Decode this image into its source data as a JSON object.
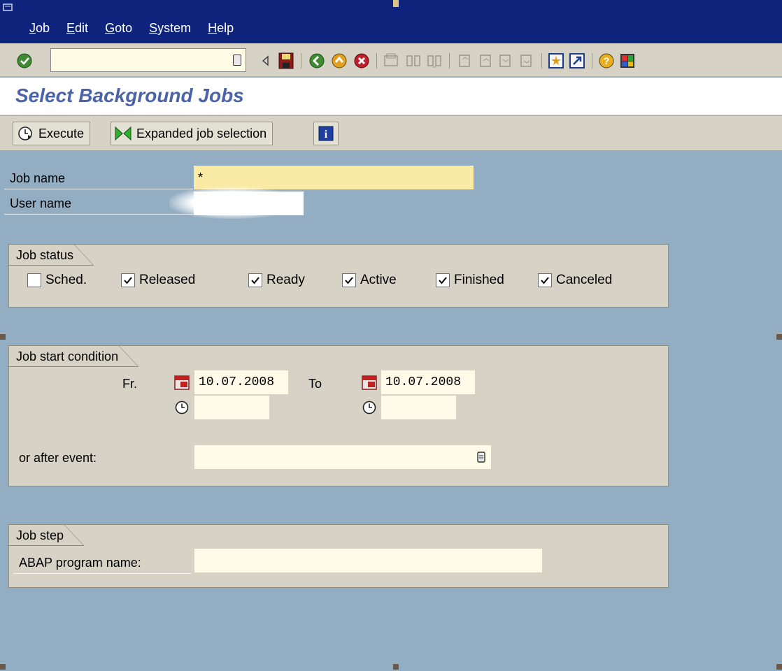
{
  "menu": {
    "items": [
      {
        "mnemonic": "J",
        "rest": "ob"
      },
      {
        "mnemonic": "E",
        "rest": "dit"
      },
      {
        "mnemonic": "G",
        "rest": "oto"
      },
      {
        "mnemonic": "S",
        "rest": "ystem"
      },
      {
        "mnemonic": "H",
        "rest": "elp"
      }
    ]
  },
  "toolbar": {
    "command_value": "",
    "icons": [
      "enter-icon",
      "save-icon",
      "back-icon",
      "exit-icon",
      "cancel-icon",
      "print-icon",
      "find-icon",
      "find-next-icon",
      "first-page-icon",
      "previous-page-icon",
      "next-page-icon",
      "last-page-icon",
      "new-session-icon",
      "shortcut-icon",
      "help-icon",
      "layout-icon"
    ]
  },
  "title": "Select Background Jobs",
  "app_toolbar": {
    "execute_label": "Execute",
    "expanded_label": "Expanded job selection"
  },
  "fields": {
    "job_name_label": "Job name",
    "job_name_value": "*",
    "user_name_label": "User name",
    "user_name_value": ""
  },
  "job_status": {
    "title": "Job status",
    "options": [
      {
        "label": "Sched.",
        "checked": false
      },
      {
        "label": "Released",
        "checked": true
      },
      {
        "label": "Ready",
        "checked": true
      },
      {
        "label": "Active",
        "checked": true
      },
      {
        "label": "Finished",
        "checked": true
      },
      {
        "label": "Canceled",
        "checked": true
      }
    ]
  },
  "job_start": {
    "title": "Job start condition",
    "from_label": "Fr.",
    "from_date": "10.07.2008",
    "to_label": "To",
    "to_date": "10.07.2008",
    "from_time": "",
    "to_time": "",
    "event_label": "or after event:",
    "event_value": ""
  },
  "job_step": {
    "title": "Job step",
    "program_label": "ABAP program name:",
    "program_value": ""
  },
  "colors": {
    "menubar": "#0e237c",
    "background": "#93adc2",
    "panel": "#d6d3c6",
    "title": "#4b63a8",
    "required_field": "#f9eaa6"
  }
}
